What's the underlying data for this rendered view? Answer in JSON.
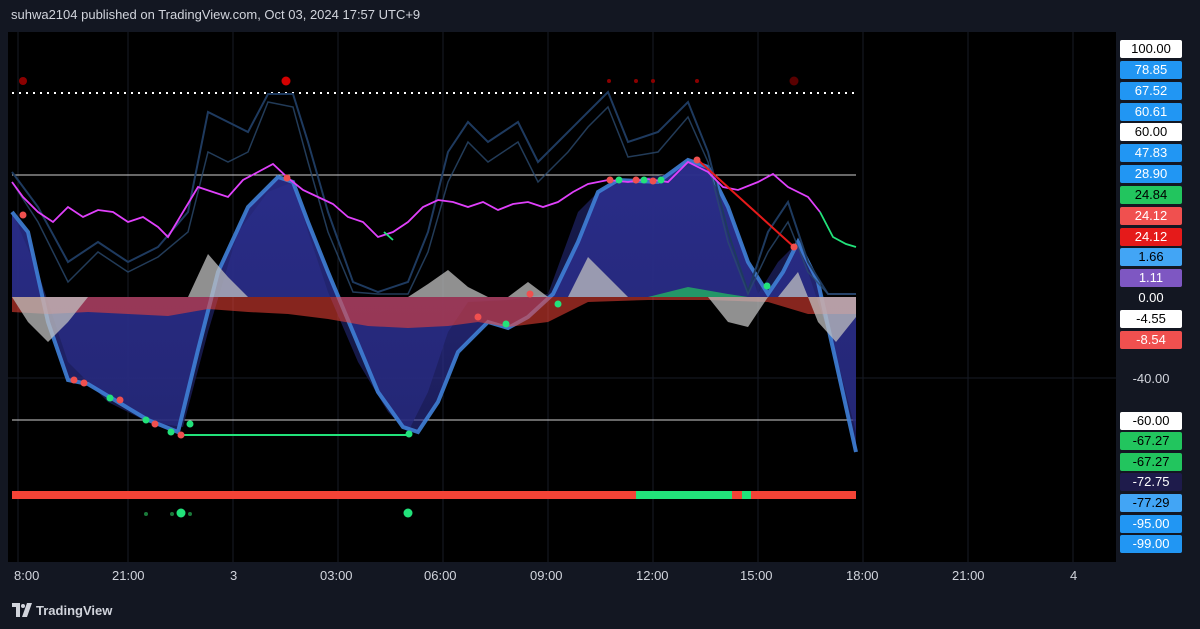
{
  "header": {
    "publish_line": "suhwa2104 published on TradingView.com, Oct 03, 2024 17:57 UTC+9"
  },
  "time_axis": {
    "ticks": [
      "8:00",
      "21:00",
      "3",
      "03:00",
      "06:00",
      "09:00",
      "12:00",
      "15:00",
      "18:00",
      "21:00",
      "4"
    ]
  },
  "price_scale": {
    "labels": [
      {
        "text": "100.00",
        "bg": "#ffffff",
        "fg": "#000000"
      },
      {
        "text": "78.85",
        "bg": "#2196f3",
        "fg": "#ffffff"
      },
      {
        "text": "67.52",
        "bg": "#2196f3",
        "fg": "#ffffff"
      },
      {
        "text": "60.61",
        "bg": "#2196f3",
        "fg": "#ffffff"
      },
      {
        "text": "60.00",
        "bg": "#ffffff",
        "fg": "#000000"
      },
      {
        "text": "47.83",
        "bg": "#2196f3",
        "fg": "#ffffff"
      },
      {
        "text": "28.90",
        "bg": "#2196f3",
        "fg": "#ffffff"
      },
      {
        "text": "24.84",
        "bg": "#22c55e",
        "fg": "#000000"
      },
      {
        "text": "24.12",
        "bg": "#f0504f",
        "fg": "#ffffff"
      },
      {
        "text": "24.12",
        "bg": "#e51a1a",
        "fg": "#ffffff"
      },
      {
        "text": "1.66",
        "bg": "#42a5f5",
        "fg": "#000000"
      },
      {
        "text": "1.11",
        "bg": "#7e57c2",
        "fg": "#ffffff"
      },
      {
        "text": "0.00",
        "bg": "",
        "fg": "#ffffff"
      },
      {
        "text": "-4.55",
        "bg": "#ffffff",
        "fg": "#000000"
      },
      {
        "text": "-8.54",
        "bg": "#f0504f",
        "fg": "#ffffff"
      },
      {
        "text": "-40.00",
        "bg": "",
        "fg": "#d1d4dc"
      },
      {
        "text": "-60.00",
        "bg": "#ffffff",
        "fg": "#000000"
      },
      {
        "text": "-67.27",
        "bg": "#22c55e",
        "fg": "#000000"
      },
      {
        "text": "-67.27",
        "bg": "#22c55e",
        "fg": "#000000"
      },
      {
        "text": "-72.75",
        "bg": "#1e1b4b",
        "fg": "#ffffff"
      },
      {
        "text": "-77.29",
        "bg": "#42a5f5",
        "fg": "#000000"
      },
      {
        "text": "-95.00",
        "bg": "#2196f3",
        "fg": "#ffffff"
      },
      {
        "text": "-99.00",
        "bg": "#2196f3",
        "fg": "#ffffff"
      }
    ]
  },
  "footer": {
    "brand": "TradingView"
  },
  "colors": {
    "bg": "#000000",
    "panel": "#131722",
    "wave": "#2f3bb0",
    "wave_edge": "#3f7fd6",
    "rsi": "#e040fb",
    "bear": "#f44336",
    "bull": "#22e27a",
    "hist": "#b0b0b0",
    "dark_line": "#1e3a5f"
  }
}
